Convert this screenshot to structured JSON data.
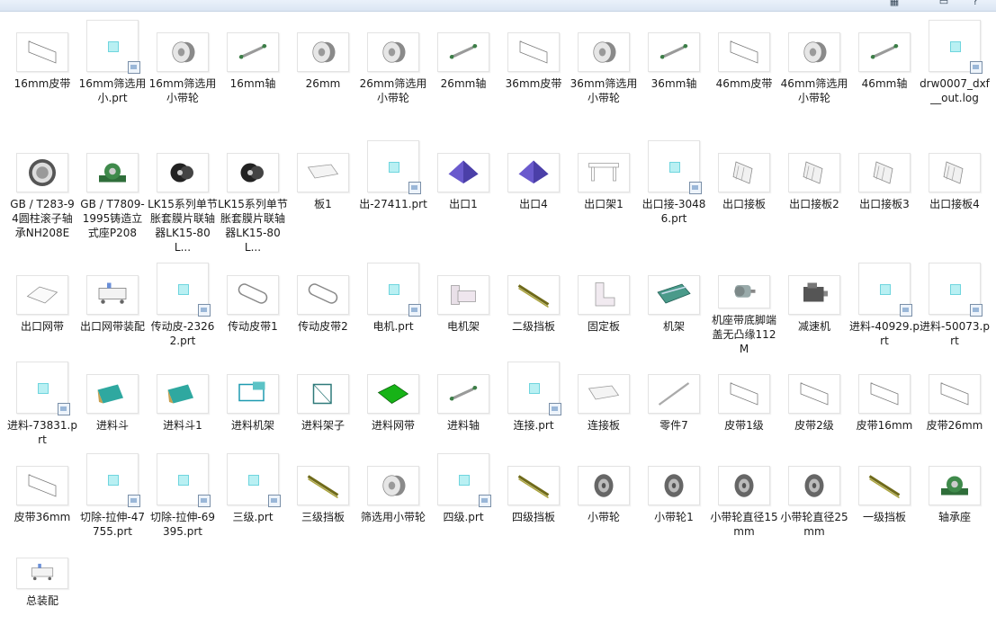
{
  "items": [
    {
      "label": "16mm皮带",
      "icon": "belt-icon"
    },
    {
      "label": "16mm筛选用小.prt",
      "icon": "prt-file-icon"
    },
    {
      "label": "16mm筛选用小带轮",
      "icon": "pulley-icon"
    },
    {
      "label": "16mm轴",
      "icon": "shaft-icon"
    },
    {
      "label": "26mm",
      "icon": "pulley-icon"
    },
    {
      "label": "26mm筛选用小带轮",
      "icon": "pulley-icon"
    },
    {
      "label": "26mm轴",
      "icon": "shaft-icon"
    },
    {
      "label": "36mm皮带",
      "icon": "belt-icon"
    },
    {
      "label": "36mm筛选用小带轮",
      "icon": "pulley-icon"
    },
    {
      "label": "36mm轴",
      "icon": "shaft-icon"
    },
    {
      "label": "46mm皮带",
      "icon": "belt-icon"
    },
    {
      "label": "46mm筛选用小带轮",
      "icon": "pulley-icon"
    },
    {
      "label": "46mm轴",
      "icon": "shaft-icon"
    },
    {
      "label": "drw0007_dxf__out.log",
      "icon": "log-file-icon"
    },
    {
      "label": "GB / T283-94圆柱滚子轴承NH208E",
      "icon": "bearing-icon"
    },
    {
      "label": "GB / T7809-1995铸造立式座P208",
      "icon": "bearing-housing-icon"
    },
    {
      "label": "LK15系列单节胀套膜片联轴器LK15-80L...",
      "icon": "coupling-icon"
    },
    {
      "label": "LK15系列单节胀套膜片联轴器LK15-80L...",
      "icon": "coupling-icon"
    },
    {
      "label": "板1",
      "icon": "plate-icon"
    },
    {
      "label": "出-27411.prt",
      "icon": "prt-file-icon"
    },
    {
      "label": "出口1",
      "icon": "pyramid-icon"
    },
    {
      "label": "出口4",
      "icon": "pyramid-icon"
    },
    {
      "label": "出口架1",
      "icon": "frame-icon"
    },
    {
      "label": "出口接-30486.prt",
      "icon": "prt-file-icon"
    },
    {
      "label": "出口接板",
      "icon": "chute-icon"
    },
    {
      "label": "出口接板2",
      "icon": "chute-icon"
    },
    {
      "label": "出口接板3",
      "icon": "chute-icon"
    },
    {
      "label": "出口接板4",
      "icon": "chute-icon"
    },
    {
      "label": "出口网带",
      "icon": "tray-icon"
    },
    {
      "label": "出口网带装配",
      "icon": "assembly-icon"
    },
    {
      "label": "传动皮-23262.prt",
      "icon": "prt-file-icon"
    },
    {
      "label": "传动皮带1",
      "icon": "drive-belt-icon"
    },
    {
      "label": "传动皮带2",
      "icon": "drive-belt-icon"
    },
    {
      "label": "电机.prt",
      "icon": "prt-file-icon"
    },
    {
      "label": "电机架",
      "icon": "motor-mount-icon"
    },
    {
      "label": "二级挡板",
      "icon": "baffle-icon"
    },
    {
      "label": "固定板",
      "icon": "bracket-icon"
    },
    {
      "label": "机架",
      "icon": "machine-frame-icon"
    },
    {
      "label": "机座带底脚端盖无凸缘112M",
      "icon": "motor-icon"
    },
    {
      "label": "减速机",
      "icon": "reducer-icon"
    },
    {
      "label": "进料-40929.prt",
      "icon": "prt-file-icon"
    },
    {
      "label": "进料-50073.prt",
      "icon": "prt-file-icon"
    },
    {
      "label": "进料-73831.prt",
      "icon": "prt-file-icon"
    },
    {
      "label": "进料斗",
      "icon": "hopper-icon"
    },
    {
      "label": "进料斗1",
      "icon": "hopper-icon"
    },
    {
      "label": "进料机架",
      "icon": "feeder-frame-icon"
    },
    {
      "label": "进料架子",
      "icon": "rack-icon"
    },
    {
      "label": "进料网带",
      "icon": "mesh-belt-icon"
    },
    {
      "label": "进料轴",
      "icon": "shaft-icon"
    },
    {
      "label": "连接.prt",
      "icon": "prt-file-icon"
    },
    {
      "label": "连接板",
      "icon": "plate-icon"
    },
    {
      "label": "零件7",
      "icon": "rod-icon"
    },
    {
      "label": "皮带1级",
      "icon": "belt-icon"
    },
    {
      "label": "皮带2级",
      "icon": "belt-icon"
    },
    {
      "label": "皮带16mm",
      "icon": "belt-icon"
    },
    {
      "label": "皮带26mm",
      "icon": "belt-icon"
    },
    {
      "label": "皮带36mm",
      "icon": "belt-icon"
    },
    {
      "label": "切除-拉伸-47755.prt",
      "icon": "prt-file-icon"
    },
    {
      "label": "切除-拉伸-69395.prt",
      "icon": "prt-file-icon"
    },
    {
      "label": "三级.prt",
      "icon": "prt-file-icon"
    },
    {
      "label": "三级挡板",
      "icon": "baffle-icon"
    },
    {
      "label": "筛选用小带轮",
      "icon": "pulley-icon"
    },
    {
      "label": "四级.prt",
      "icon": "prt-file-icon"
    },
    {
      "label": "四级挡板",
      "icon": "baffle-icon"
    },
    {
      "label": "小带轮",
      "icon": "wheel-icon"
    },
    {
      "label": "小带轮1",
      "icon": "wheel-icon"
    },
    {
      "label": "小带轮直径15mm",
      "icon": "wheel-icon"
    },
    {
      "label": "小带轮直径25mm",
      "icon": "wheel-icon"
    },
    {
      "label": "一级挡板",
      "icon": "baffle-icon"
    },
    {
      "label": "轴承座",
      "icon": "bearing-housing-icon"
    },
    {
      "label": "总装配",
      "icon": "assembly-icon"
    }
  ]
}
